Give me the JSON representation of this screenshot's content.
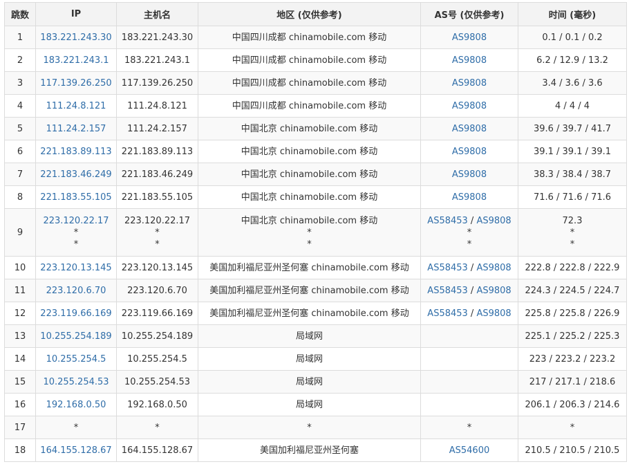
{
  "headers": [
    "跳数",
    "IP",
    "主机名",
    "地区 (仅供参考)",
    "AS号 (仅供参考)",
    "时间 (毫秒)"
  ],
  "rows": [
    {
      "hop": "1",
      "ip": [
        "183.221.243.30"
      ],
      "host": [
        "183.221.243.30"
      ],
      "region": [
        "中国四川成都 chinamobile.com 移动"
      ],
      "as": [
        [
          "AS9808"
        ]
      ],
      "time": [
        "0.1 / 0.1 / 0.2"
      ]
    },
    {
      "hop": "2",
      "ip": [
        "183.221.243.1"
      ],
      "host": [
        "183.221.243.1"
      ],
      "region": [
        "中国四川成都 chinamobile.com 移动"
      ],
      "as": [
        [
          "AS9808"
        ]
      ],
      "time": [
        "6.2 / 12.9 / 13.2"
      ]
    },
    {
      "hop": "3",
      "ip": [
        "117.139.26.250"
      ],
      "host": [
        "117.139.26.250"
      ],
      "region": [
        "中国四川成都 chinamobile.com 移动"
      ],
      "as": [
        [
          "AS9808"
        ]
      ],
      "time": [
        "3.4 / 3.6 / 3.6"
      ]
    },
    {
      "hop": "4",
      "ip": [
        "111.24.8.121"
      ],
      "host": [
        "111.24.8.121"
      ],
      "region": [
        "中国四川成都 chinamobile.com 移动"
      ],
      "as": [
        [
          "AS9808"
        ]
      ],
      "time": [
        "4 / 4 / 4"
      ]
    },
    {
      "hop": "5",
      "ip": [
        "111.24.2.157"
      ],
      "host": [
        "111.24.2.157"
      ],
      "region": [
        "中国北京 chinamobile.com 移动"
      ],
      "as": [
        [
          "AS9808"
        ]
      ],
      "time": [
        "39.6 / 39.7 / 41.7"
      ]
    },
    {
      "hop": "6",
      "ip": [
        "221.183.89.113"
      ],
      "host": [
        "221.183.89.113"
      ],
      "region": [
        "中国北京 chinamobile.com 移动"
      ],
      "as": [
        [
          "AS9808"
        ]
      ],
      "time": [
        "39.1 / 39.1 / 39.1"
      ]
    },
    {
      "hop": "7",
      "ip": [
        "221.183.46.249"
      ],
      "host": [
        "221.183.46.249"
      ],
      "region": [
        "中国北京 chinamobile.com 移动"
      ],
      "as": [
        [
          "AS9808"
        ]
      ],
      "time": [
        "38.3 / 38.4 / 38.7"
      ]
    },
    {
      "hop": "8",
      "ip": [
        "221.183.55.105"
      ],
      "host": [
        "221.183.55.105"
      ],
      "region": [
        "中国北京 chinamobile.com 移动"
      ],
      "as": [
        [
          "AS9808"
        ]
      ],
      "time": [
        "71.6 / 71.6 / 71.6"
      ]
    },
    {
      "hop": "9",
      "ip": [
        "223.120.22.17",
        "*",
        "*"
      ],
      "host": [
        "223.120.22.17",
        "*",
        "*"
      ],
      "region": [
        "中国北京 chinamobile.com 移动",
        "*",
        "*"
      ],
      "as": [
        [
          "AS58453",
          "AS9808"
        ],
        [
          "*"
        ],
        [
          "*"
        ]
      ],
      "time": [
        "72.3",
        "*",
        "*"
      ]
    },
    {
      "hop": "10",
      "ip": [
        "223.120.13.145"
      ],
      "host": [
        "223.120.13.145"
      ],
      "region": [
        "美国加利福尼亚州圣何塞 chinamobile.com 移动"
      ],
      "as": [
        [
          "AS58453",
          "AS9808"
        ]
      ],
      "time": [
        "222.8 / 222.8 / 222.9"
      ]
    },
    {
      "hop": "11",
      "ip": [
        "223.120.6.70"
      ],
      "host": [
        "223.120.6.70"
      ],
      "region": [
        "美国加利福尼亚州圣何塞 chinamobile.com 移动"
      ],
      "as": [
        [
          "AS58453",
          "AS9808"
        ]
      ],
      "time": [
        "224.3 / 224.5 / 224.7"
      ]
    },
    {
      "hop": "12",
      "ip": [
        "223.119.66.169"
      ],
      "host": [
        "223.119.66.169"
      ],
      "region": [
        "美国加利福尼亚州圣何塞 chinamobile.com 移动"
      ],
      "as": [
        [
          "AS58453",
          "AS9808"
        ]
      ],
      "time": [
        "225.8 / 225.8 / 226.9"
      ]
    },
    {
      "hop": "13",
      "ip": [
        "10.255.254.189"
      ],
      "host": [
        "10.255.254.189"
      ],
      "region": [
        "局域网"
      ],
      "as": [],
      "time": [
        "225.1 / 225.2 / 225.3"
      ]
    },
    {
      "hop": "14",
      "ip": [
        "10.255.254.5"
      ],
      "host": [
        "10.255.254.5"
      ],
      "region": [
        "局域网"
      ],
      "as": [],
      "time": [
        "223 / 223.2 / 223.2"
      ]
    },
    {
      "hop": "15",
      "ip": [
        "10.255.254.53"
      ],
      "host": [
        "10.255.254.53"
      ],
      "region": [
        "局域网"
      ],
      "as": [],
      "time": [
        "217 / 217.1 / 218.6"
      ]
    },
    {
      "hop": "16",
      "ip": [
        "192.168.0.50"
      ],
      "host": [
        "192.168.0.50"
      ],
      "region": [
        "局域网"
      ],
      "as": [],
      "time": [
        "206.1 / 206.3 / 214.6"
      ]
    },
    {
      "hop": "17",
      "ip": [
        "*"
      ],
      "host": [
        "*"
      ],
      "region": [
        "*"
      ],
      "as": [
        [
          "*"
        ]
      ],
      "time": [
        "*"
      ]
    },
    {
      "hop": "18",
      "ip": [
        "164.155.128.67"
      ],
      "host": [
        "164.155.128.67"
      ],
      "region": [
        "美国加利福尼亚州圣何塞"
      ],
      "as": [
        [
          "AS54600"
        ]
      ],
      "time": [
        "210.5 / 210.5 / 210.5"
      ]
    }
  ],
  "as_separator": " / ",
  "colors": {
    "link": "#2f6da8",
    "header_bg": "#f3f3f3",
    "row_alt_bg": "#f9f9f9",
    "border": "#dcdcdc",
    "text": "#333333"
  }
}
